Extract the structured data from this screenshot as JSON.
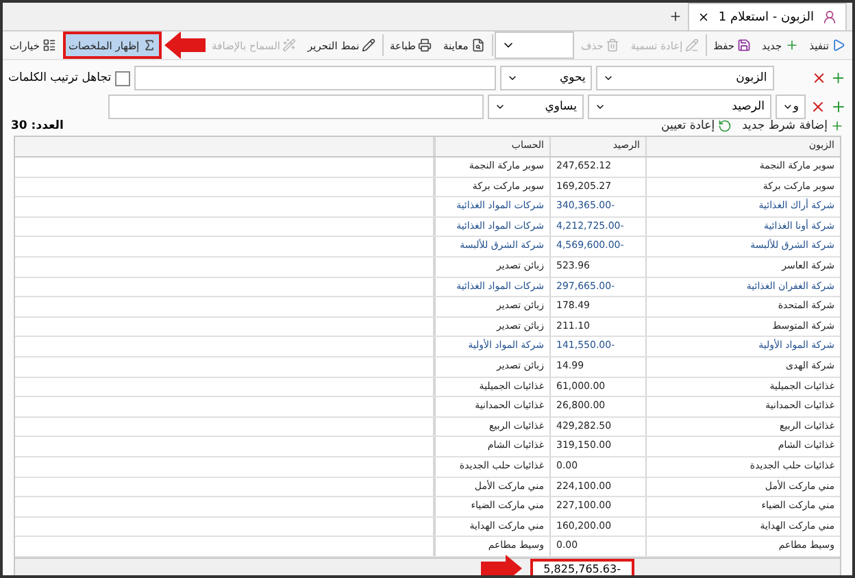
{
  "tabs": [
    {
      "title": "الزبون - استعلام 1",
      "selected": true
    }
  ],
  "toolbar": [
    {
      "kind": "button",
      "label": "تنفيذ",
      "disabled": false,
      "selected": false,
      "highlighted": false
    },
    {
      "kind": "button",
      "label": "جديد",
      "disabled": false,
      "selected": false,
      "highlighted": false
    },
    {
      "kind": "button",
      "label": "حفظ",
      "disabled": false,
      "selected": false,
      "highlighted": false
    },
    {
      "kind": "separator"
    },
    {
      "kind": "button",
      "label": "إعادة تسمية",
      "disabled": true,
      "selected": false,
      "highlighted": false
    },
    {
      "kind": "button",
      "label": "حذف",
      "disabled": true,
      "selected": false,
      "highlighted": false
    },
    {
      "kind": "combo"
    },
    {
      "kind": "separator"
    },
    {
      "kind": "button",
      "label": "معاينة",
      "disabled": false,
      "selected": false,
      "highlighted": false
    },
    {
      "kind": "button",
      "label": "طباعة",
      "disabled": false,
      "selected": false,
      "highlighted": false
    },
    {
      "kind": "separator"
    },
    {
      "kind": "button",
      "label": "نمط التحرير",
      "disabled": false,
      "selected": false,
      "highlighted": false
    },
    {
      "kind": "button",
      "label": "السماح بالإضافة",
      "disabled": true,
      "selected": false,
      "highlighted": false
    },
    {
      "kind": "button",
      "label": "إظهار الملخصات",
      "disabled": false,
      "selected": true,
      "highlighted": true
    },
    {
      "kind": "button",
      "label": "خيارات",
      "disabled": false,
      "selected": false,
      "highlighted": false
    }
  ],
  "filters": [
    {
      "field": "الزبون",
      "operator": "يحوي"
    },
    {
      "connector": "و",
      "field": "الرصيد",
      "operator": "يساوي"
    }
  ],
  "ignore_word_order": {
    "label": "تجاهل ترتيب الكلمات",
    "checked": false
  },
  "actions": [
    "إضافة شرط جديد",
    "إعادة تعيين"
  ],
  "count": "العدد: 30",
  "table": {
    "columns": [
      "الزبون",
      "الرصيد",
      "الحساب"
    ],
    "rows": [
      {
        "cells": [
          "سوبر ماركة النجمة",
          "247,652.12",
          "سوبر ماركة النجمة"
        ],
        "link": false
      },
      {
        "cells": [
          "سوبر ماركت بركة",
          "169,205.27",
          "سوبر ماركت بركة"
        ],
        "link": false
      },
      {
        "cells": [
          "شركة أراك الغذائية",
          "-340,365.00",
          "شركات المواد الغذائية"
        ],
        "link": true
      },
      {
        "cells": [
          "شركة أونا الغذائية",
          "-4,212,725.00",
          "شركات المواد الغذائية"
        ],
        "link": true
      },
      {
        "cells": [
          "شركة الشرق للألبسة",
          "-4,569,600.00",
          "شركة الشرق للألبسة"
        ],
        "link": true
      },
      {
        "cells": [
          "شركة العاسر",
          "523.96",
          "زبائن تصدير"
        ],
        "link": false
      },
      {
        "cells": [
          "شركة الغفران الغذائية",
          "-297,665.00",
          "شركات المواد الغذائية"
        ],
        "link": true
      },
      {
        "cells": [
          "شركة المتحدة",
          "178.49",
          "زبائن تصدير"
        ],
        "link": false
      },
      {
        "cells": [
          "شركة المتوسط",
          "211.10",
          "زبائن تصدير"
        ],
        "link": false
      },
      {
        "cells": [
          "شركة المواد الأولية",
          "-141,550.00",
          "شركة المواد الأولية"
        ],
        "link": true
      },
      {
        "cells": [
          "شركة الهدى",
          "14.99",
          "زبائن تصدير"
        ],
        "link": false
      },
      {
        "cells": [
          "غذائيات الجميلية",
          "61,000.00",
          "غذائيات الجميلية"
        ],
        "link": false
      },
      {
        "cells": [
          "غذائيات الحمدانية",
          "26,800.00",
          "غذائيات الحمدانية"
        ],
        "link": false
      },
      {
        "cells": [
          "غذائيات الربيع",
          "429,282.50",
          "غذائيات الربيع"
        ],
        "link": false
      },
      {
        "cells": [
          "غذائيات الشام",
          "319,150.00",
          "غذائيات الشام"
        ],
        "link": false
      },
      {
        "cells": [
          "غذائيات حلب الجديدة",
          "0.00",
          "غذائيات حلب الجديدة"
        ],
        "link": false
      },
      {
        "cells": [
          "مني ماركت الأمل",
          "224,100.00",
          "مني ماركت الأمل"
        ],
        "link": false
      },
      {
        "cells": [
          "مني ماركت الضياء",
          "227,100.00",
          "مني ماركت الضياء"
        ],
        "link": false
      },
      {
        "cells": [
          "مني ماركت الهداية",
          "160,200.00",
          "مني ماركت الهداية"
        ],
        "link": false
      },
      {
        "cells": [
          "وسيط مطاعم",
          "0.00",
          "وسيط مطاعم"
        ],
        "link": false
      }
    ],
    "total": {
      "value": "-5,825,765.63",
      "highlighted": true
    }
  }
}
